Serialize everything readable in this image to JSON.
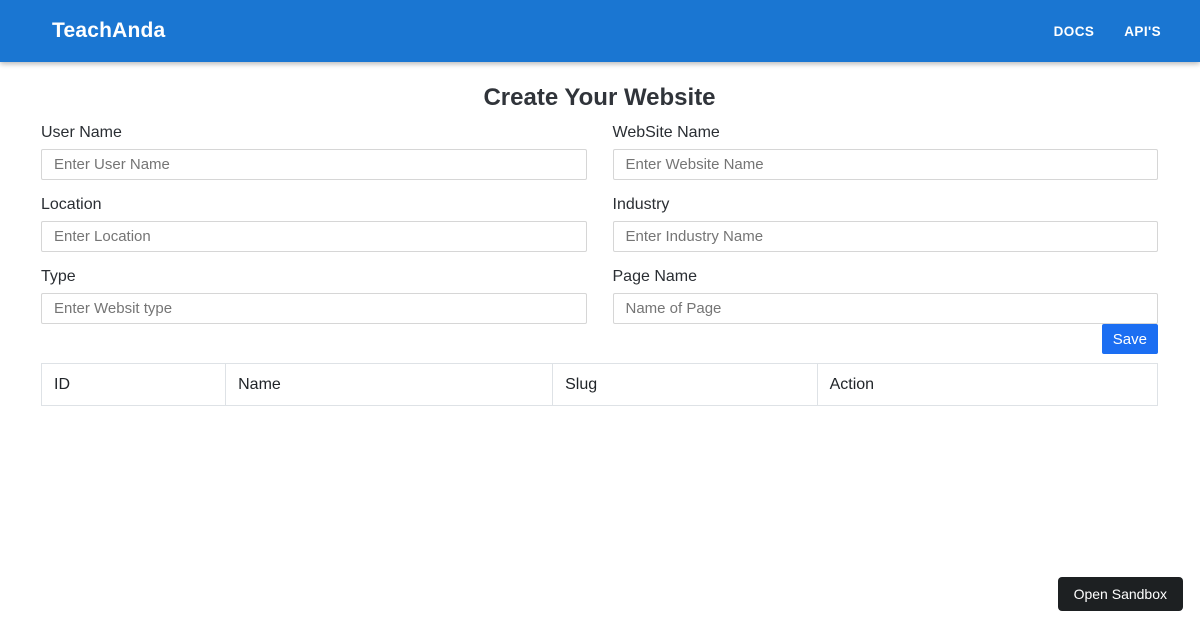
{
  "navbar": {
    "brand": "TeachAnda",
    "links": [
      {
        "label": "DOCS"
      },
      {
        "label": "API'S"
      }
    ]
  },
  "page": {
    "title": "Create Your Website"
  },
  "form": {
    "fields": [
      {
        "label": "User Name",
        "placeholder": "Enter User Name",
        "value": ""
      },
      {
        "label": "WebSite Name",
        "placeholder": "Enter Website Name",
        "value": ""
      },
      {
        "label": "Location",
        "placeholder": "Enter Location",
        "value": ""
      },
      {
        "label": "Industry",
        "placeholder": "Enter Industry Name",
        "value": ""
      },
      {
        "label": "Type",
        "placeholder": "Enter Websit type",
        "value": ""
      },
      {
        "label": "Page Name",
        "placeholder": "Name of Page",
        "value": ""
      }
    ],
    "save_label": "Save"
  },
  "table": {
    "headers": [
      "ID",
      "Name",
      "Slug",
      "Action"
    ],
    "rows": []
  },
  "sandbox": {
    "open_label": "Open Sandbox"
  },
  "colors": {
    "navbar_blue": "#1a76d2",
    "save_blue": "#1b6ef2",
    "sandbox_dark": "#1d2022",
    "input_border": "#d6d6d6",
    "table_border": "#dee2e6"
  }
}
